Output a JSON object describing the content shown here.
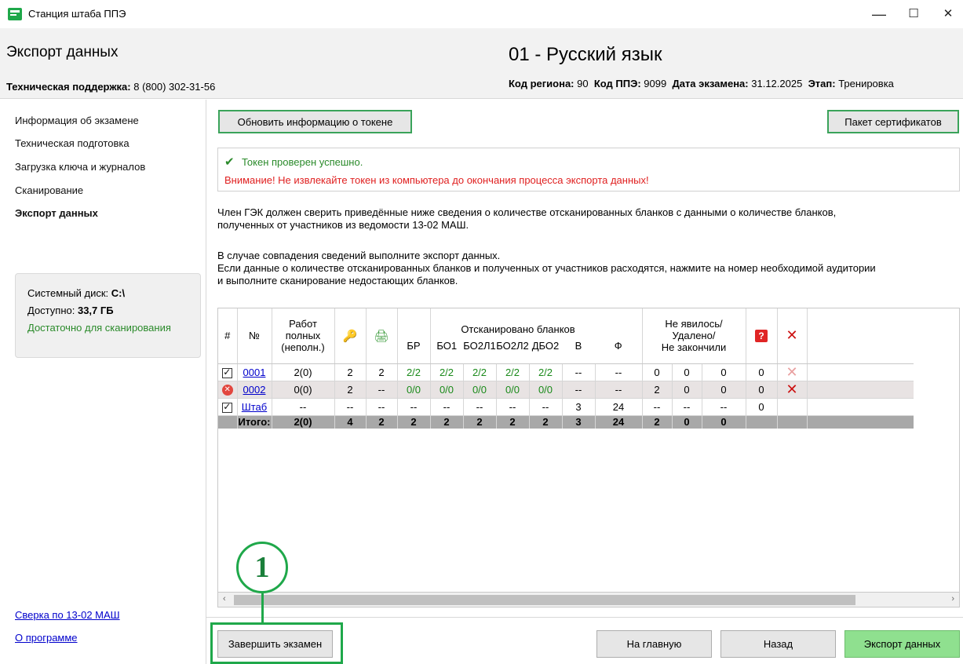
{
  "window": {
    "title": "Станция штаба ППЭ",
    "min_glyph": "—",
    "max_glyph": "☐",
    "close_glyph": "✕"
  },
  "header": {
    "page_title": "Экспорт данных",
    "support_label": "Техническая поддержка:",
    "support_phone": "8 (800) 302-31-56",
    "exam_title": "01 - Русский язык",
    "region_label": "Код региона:",
    "region_value": "90",
    "ppe_label": "Код ППЭ:",
    "ppe_value": "9099",
    "date_label": "Дата экзамена:",
    "date_value": "31.12.2025",
    "stage_label": "Этап:",
    "stage_value": "Тренировка"
  },
  "sidebar": {
    "items": [
      {
        "label": "Информация об экзамене"
      },
      {
        "label": "Техническая подготовка"
      },
      {
        "label": "Загрузка ключа и журналов"
      },
      {
        "label": "Сканирование"
      },
      {
        "label": "Экспорт данных"
      }
    ],
    "disk": {
      "label": "Системный диск:",
      "drive": "C:\\",
      "free_label": "Доступно:",
      "free_value": "33,7 ГБ",
      "status": "Достаточно для сканирования"
    },
    "links": {
      "reconcile": "Сверка по 13-02 МАШ",
      "about": "О программе"
    }
  },
  "toolbar": {
    "refresh_token": "Обновить информацию о токене",
    "cert_package": "Пакет сертификатов"
  },
  "status": {
    "ok": "Токен проверен успешно.",
    "warning": "Внимание! Не извлекайте токен из компьютера до окончания процесса экспорта данных!"
  },
  "instructions": {
    "p1_line1": "Член ГЭК должен сверить приведённые ниже сведения о количестве отсканированных бланков с данными о количестве бланков,",
    "p1_line2": "полученных от участников из ведомости 13-02 МАШ.",
    "p2_line1": "В случае совпадения сведений выполните экспорт данных.",
    "p2_line2": "Если данные о количестве отсканированных бланков и полученных от участников расходятся, нажмите на номер необходимой аудитории",
    "p2_line3": "и выполните сканирование недостающих бланков."
  },
  "table": {
    "headers": {
      "hash": "#",
      "num": "№",
      "works_1": "Работ",
      "works_2": "полных",
      "works_3": "(неполн.)",
      "scanned_group": "Отсканировано бланков",
      "br": "БР",
      "bo1": "БО1",
      "bo2l1": "БО2Л1",
      "bo2l2": "БО2Л2",
      "dbo2": "ДБО2",
      "v": "В",
      "f": "Ф",
      "absent_1": "Не явилось/",
      "absent_2": "Удалено/",
      "absent_3": "Не закончили",
      "help_icon": "?"
    },
    "rows": [
      {
        "num": "0001",
        "works": "2(0)",
        "keys": "2",
        "print": "2",
        "br": "2/2",
        "bo1": "2/2",
        "bo2l1": "2/2",
        "bo2l2": "2/2",
        "dbo2": "2/2",
        "v": "--",
        "f": "--",
        "a": "0",
        "b": "0",
        "c": "0",
        "q": "0"
      },
      {
        "num": "0002",
        "works": "0(0)",
        "keys": "2",
        "print": "--",
        "br": "0/0",
        "bo1": "0/0",
        "bo2l1": "0/0",
        "bo2l2": "0/0",
        "dbo2": "0/0",
        "v": "--",
        "f": "--",
        "a": "2",
        "b": "0",
        "c": "0",
        "q": "0"
      },
      {
        "num": "Штаб",
        "works": "--",
        "keys": "--",
        "print": "--",
        "br": "--",
        "bo1": "--",
        "bo2l1": "--",
        "bo2l2": "--",
        "dbo2": "--",
        "v": "3",
        "f": "24",
        "a": "--",
        "b": "--",
        "c": "--",
        "q": "0"
      }
    ],
    "total": {
      "label": "Итого:",
      "works": "2(0)",
      "keys": "4",
      "print": "2",
      "br": "2",
      "bo1": "2",
      "bo2l1": "2",
      "bo2l2": "2",
      "dbo2": "2",
      "v": "3",
      "f": "24",
      "a": "2",
      "b": "0",
      "c": "0"
    }
  },
  "footer": {
    "finish": "Завершить экзамен",
    "home": "На главную",
    "back": "Назад",
    "export": "Экспорт данных"
  },
  "annotation": {
    "number": "1"
  },
  "colors": {
    "accent_green": "#1fa84a",
    "error_red": "#e02020",
    "ok_green": "#2a8a2a",
    "export_button": "#8fe08f"
  }
}
